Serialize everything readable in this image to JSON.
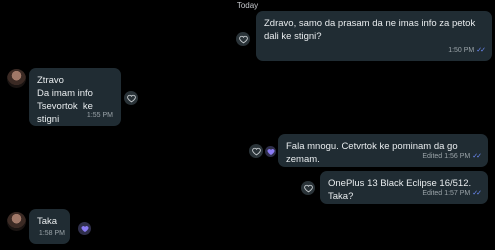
{
  "date_separator": "Today",
  "messages": [
    {
      "dir": "out",
      "text": "Zdravo, samo da prasam da ne imas info za petok dali ke stigni?",
      "time": "1:50 PM",
      "edited": ""
    },
    {
      "dir": "in",
      "text": "Ztravo\nDa imam info\nTsevortok  ke stigni",
      "time": "1:55 PM",
      "edited": ""
    },
    {
      "dir": "out",
      "text": "Fala mnogu. Cetvrtok ke pominam da go zemam.",
      "time": "1:56 PM",
      "edited": "Edited"
    },
    {
      "dir": "out",
      "text": "OnePlus 13 Black Eclipse 16/512. Taka?",
      "time": "1:57 PM",
      "edited": "Edited"
    },
    {
      "dir": "in",
      "text": "Taka",
      "time": "1:58 PM",
      "edited": ""
    }
  ],
  "colors": {
    "bubble": "#202c33",
    "background": "#000000",
    "tick": "#6f8fff",
    "reaction": "#8b7cf6"
  },
  "icons": {
    "react": "heart-outline-icon",
    "reacted": "heart-filled-icon",
    "read": "double-check-icon"
  }
}
